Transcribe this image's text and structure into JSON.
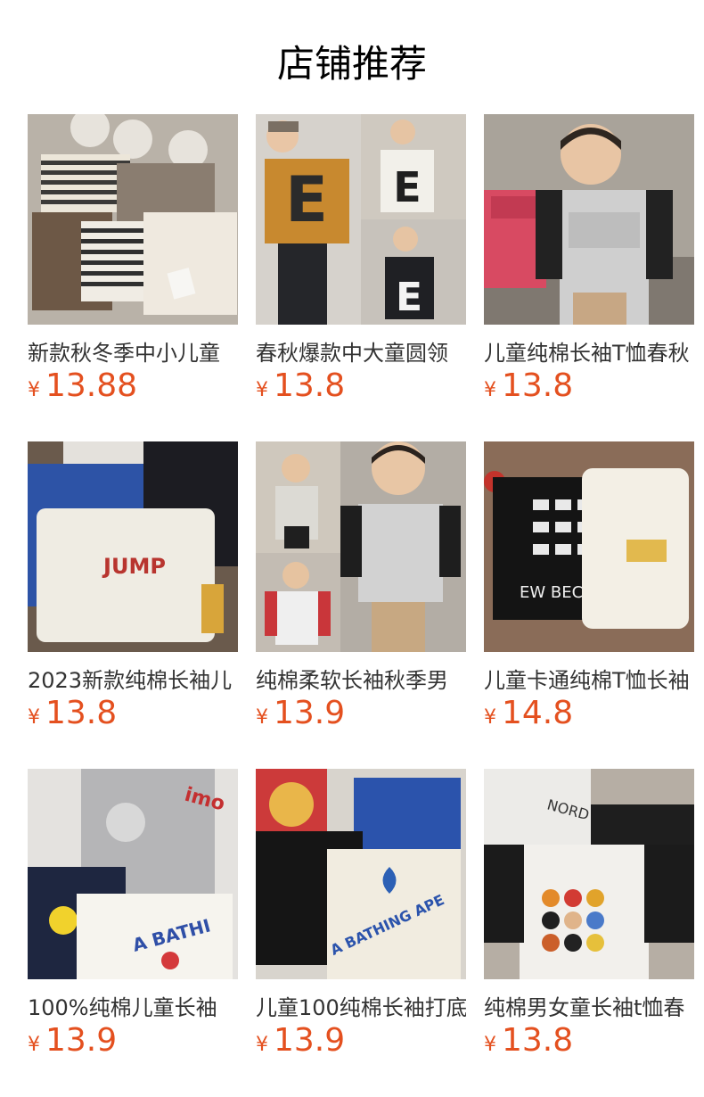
{
  "section": {
    "title": "店铺推荐"
  },
  "products": [
    {
      "name": "新款秋冬季中小儿童",
      "currency": "¥",
      "price": "13.88",
      "image_desc": "stripe-shirt-photo"
    },
    {
      "name": "春秋爆款中大童圆领",
      "currency": "¥",
      "price": "13.8",
      "image_desc": "letter-e-shirt-photo"
    },
    {
      "name": "儿童纯棉长袖T恤春秋",
      "currency": "¥",
      "price": "13.8",
      "image_desc": "kid-raglan-photo"
    },
    {
      "name": "2023新款纯棉长袖儿",
      "currency": "¥",
      "price": "13.8",
      "image_desc": "jump-shirt-photo"
    },
    {
      "name": "纯棉柔软长袖秋季男",
      "currency": "¥",
      "price": "13.9",
      "image_desc": "kid-raglan-collage-photo"
    },
    {
      "name": "儿童卡通纯棉T恤长袖",
      "currency": "¥",
      "price": "14.8",
      "image_desc": "sneaker-shirt-photo"
    },
    {
      "name": "100%纯棉儿童长袖",
      "currency": "¥",
      "price": "13.9",
      "image_desc": "cartoon-shirt-photo"
    },
    {
      "name": "儿童100纯棉长袖打底",
      "currency": "¥",
      "price": "13.9",
      "image_desc": "bathing-ape-shirt-photo"
    },
    {
      "name": "纯棉男女童长袖t恤春",
      "currency": "¥",
      "price": "13.8",
      "image_desc": "character-shirt-photo"
    }
  ],
  "colors": {
    "price": "#e4501f",
    "text": "#333333"
  }
}
